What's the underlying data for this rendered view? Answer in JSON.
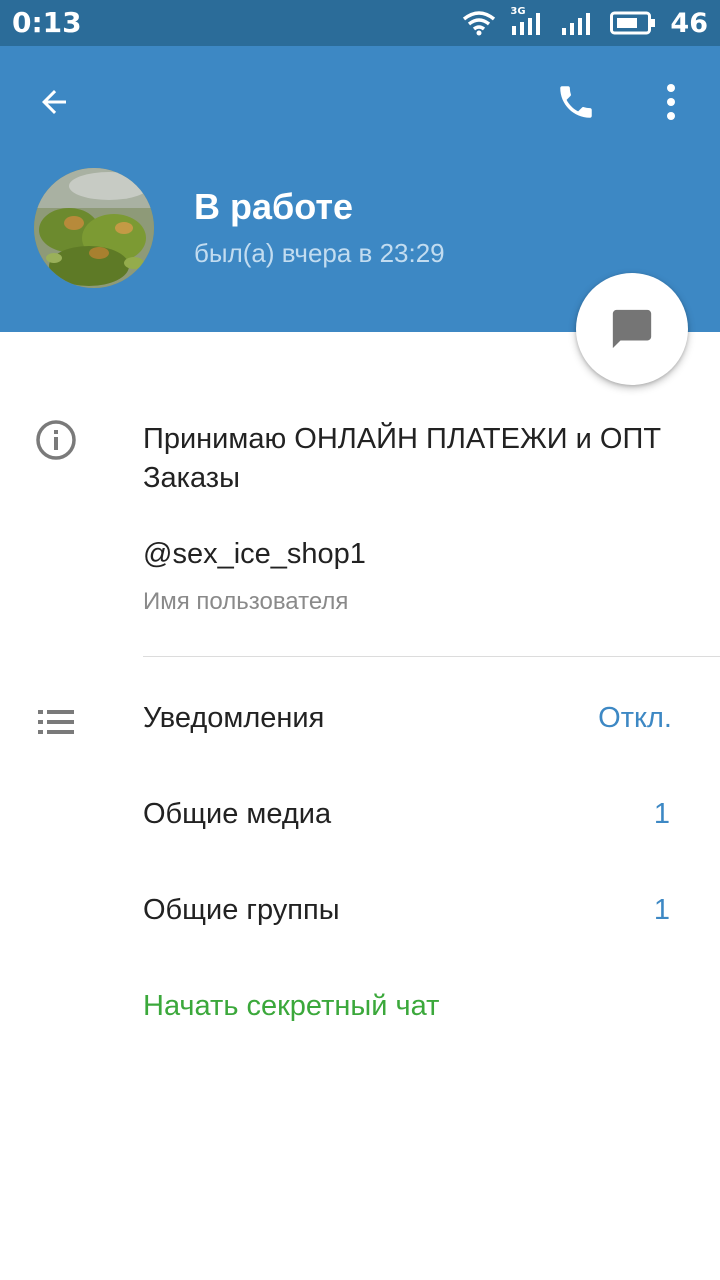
{
  "status_bar": {
    "time": "0:13",
    "network_type": "3G",
    "battery_level": "46"
  },
  "header": {
    "name": "В работе",
    "last_seen": "был(а) вчера в 23:29",
    "background_color": "#3d88c4"
  },
  "icons": {
    "back": "arrow-left-icon",
    "call": "phone-icon",
    "menu": "more-vertical-icon",
    "message": "message-icon",
    "info": "info-icon",
    "notifications": "list-icon"
  },
  "info": {
    "bio": "Принимаю ОНЛАЙН ПЛАТЕЖИ и ОПТ Заказы",
    "username": "@sex_ice_shop1",
    "username_caption": "Имя пользователя"
  },
  "rows": [
    {
      "label": "Уведомления",
      "value": "Откл."
    },
    {
      "label": "Общие медиа",
      "value": "1"
    },
    {
      "label": "Общие группы",
      "value": "1"
    }
  ],
  "secret_chat": {
    "label": "Начать секретный чат",
    "color": "#3ba83b"
  },
  "accent_color": "#3d88c4"
}
